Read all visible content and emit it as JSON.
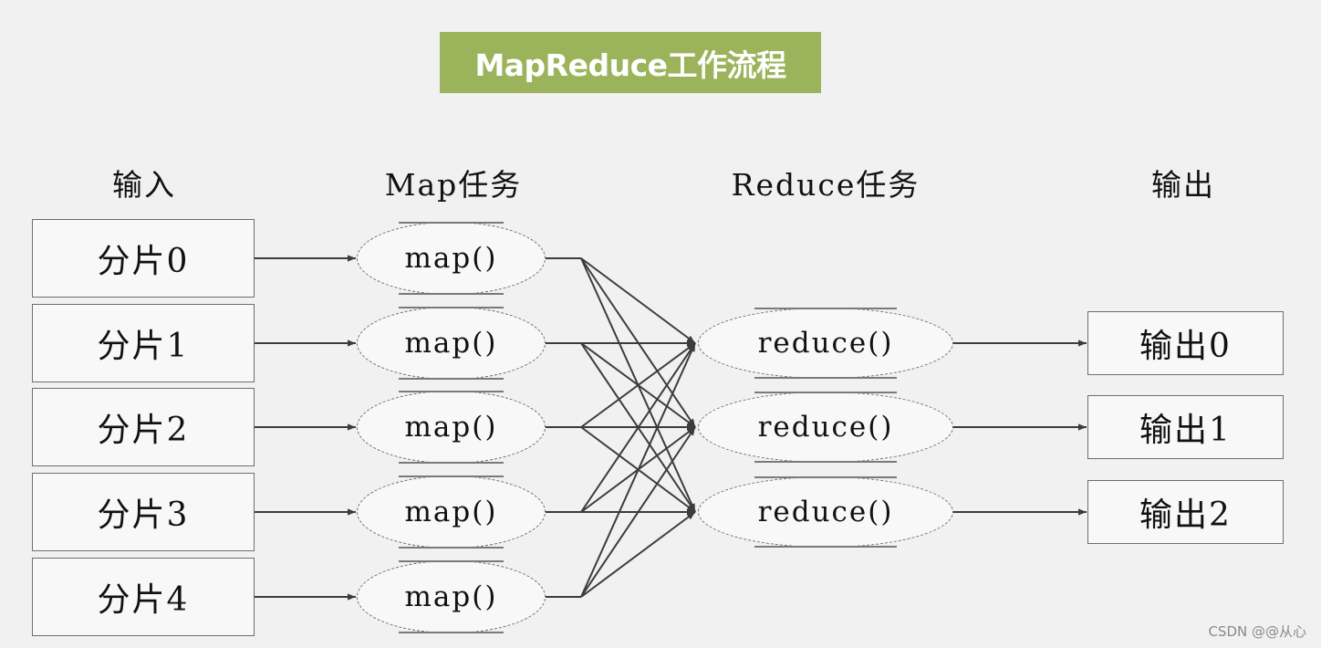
{
  "title": "MapReduce工作流程",
  "colors": {
    "title_bg": "#9bb35a",
    "title_text": "#ffffff",
    "background": "#f1f1f1",
    "line": "#3c3c3c"
  },
  "columns": {
    "input": "输入",
    "map": "Map任务",
    "reduce": "Reduce任务",
    "output": "输出"
  },
  "inputs": [
    "分片0",
    "分片1",
    "分片2",
    "分片3",
    "分片4"
  ],
  "maps": [
    "map()",
    "map()",
    "map()",
    "map()",
    "map()"
  ],
  "reduces": [
    "reduce()",
    "reduce()",
    "reduce()"
  ],
  "outputs": [
    "输出0",
    "输出1",
    "输出2"
  ],
  "edges": {
    "input_to_map": [
      [
        0,
        0
      ],
      [
        1,
        1
      ],
      [
        2,
        2
      ],
      [
        3,
        3
      ],
      [
        4,
        4
      ]
    ],
    "map_to_reduce": "all-to-all",
    "reduce_to_output": [
      [
        0,
        0
      ],
      [
        1,
        1
      ],
      [
        2,
        2
      ]
    ]
  },
  "watermark": "CSDN @@从心"
}
